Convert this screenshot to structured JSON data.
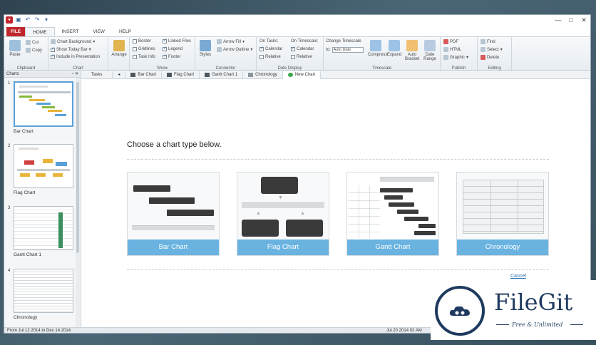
{
  "quick_access": {
    "icons": [
      "app-logo-icon",
      "save-icon",
      "undo-icon",
      "redo-icon",
      "dropdown-icon"
    ]
  },
  "window_controls": {
    "minimize": "—",
    "maximize": "□",
    "close": "✕"
  },
  "menu": {
    "tabs": [
      "FILE",
      "HOME",
      "INSERT",
      "VIEW",
      "HELP"
    ],
    "active": "HOME"
  },
  "ribbon": {
    "clipboard": {
      "label": "Clipboard",
      "paste": "Paste",
      "cut": "Cut",
      "copy": "Copy"
    },
    "chart": {
      "label": "Chart",
      "background": "Chart Background",
      "show_today": "Show Today Bar",
      "include": "Include in Presentation"
    },
    "arrange": {
      "label": "Arrange"
    },
    "show": {
      "label": "Show",
      "items": [
        "Border",
        "Gridlines",
        "Task Info",
        "Linked Files",
        "Legend",
        "Footer"
      ]
    },
    "connector": {
      "label": "Connector",
      "styles": "Styles",
      "arrow_fill": "Arrow Fill",
      "arrow_outline": "Arrow Outline"
    },
    "date_display": {
      "label": "Date Display",
      "on_tasks": "On Tasks:",
      "on_timescale": "On Timescale:",
      "calendar1": "Calendar",
      "relative1": "Relative",
      "calendar2": "Calendar",
      "relative2": "Relative"
    },
    "timescale": {
      "label": "Timescale",
      "change": "Change Timescale",
      "to": "to:",
      "select_value": "Auto Date",
      "compress": "Compress",
      "expand": "Expand",
      "auto_bracket": "Auto Bracket",
      "date_range": "Date Range"
    },
    "publish": {
      "label": "Publish",
      "pdf": "PDF",
      "html": "HTML",
      "graphic": "Graphic"
    },
    "editing": {
      "label": "Editing",
      "find": "Find",
      "select": "Select",
      "delete": "Delete"
    }
  },
  "doc_tabs": [
    "Tasks",
    "Bar Chart",
    "Flag Chart",
    "Gantt Chart 1",
    "Chronology",
    "New Chart"
  ],
  "left_pane": {
    "title": "Charts",
    "items": [
      {
        "num": "1",
        "label": "Bar Chart"
      },
      {
        "num": "2",
        "label": "Flag Chart"
      },
      {
        "num": "3",
        "label": "Gantt Chart 1"
      },
      {
        "num": "4",
        "label": "Chronology"
      }
    ]
  },
  "main": {
    "heading": "Choose a chart type below.",
    "cards": [
      "Bar Chart",
      "Flag Chart",
      "Gantt Chart",
      "Chronology"
    ],
    "cancel": "Cancel"
  },
  "status": {
    "left": "From Jul 12 2014 to Dec 14 2014",
    "right": "Jul 20 2014 02 AM"
  },
  "watermark": {
    "title": "FileGit",
    "subtitle": "Free & Unlimited"
  },
  "colors": {
    "accent": "#6ab3e0",
    "file_tab": "#c0272d",
    "watermark": "#1f3a5f"
  }
}
